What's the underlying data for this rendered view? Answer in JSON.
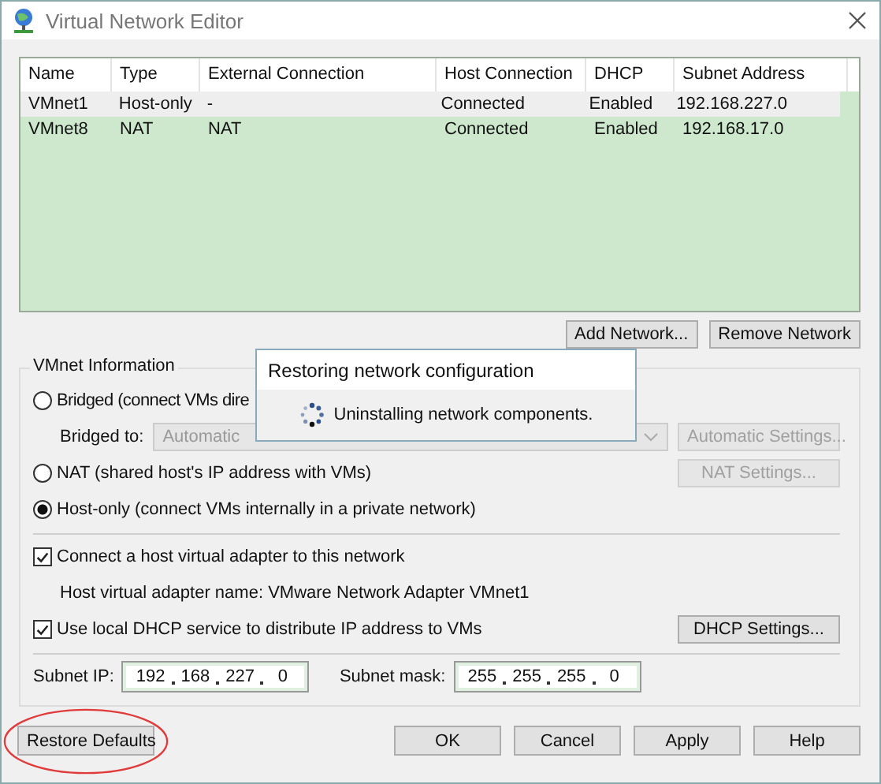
{
  "window": {
    "title": "Virtual Network Editor"
  },
  "table": {
    "columns": [
      "Name",
      "Type",
      "External Connection",
      "Host Connection",
      "DHCP",
      "Subnet Address"
    ],
    "rows": [
      {
        "cells": [
          "VMnet1",
          "Host-only",
          "-",
          "Connected",
          "Enabled",
          "192.168.227.0"
        ],
        "selected": true
      },
      {
        "cells": [
          "VMnet8",
          "NAT",
          "NAT",
          "Connected",
          "Enabled",
          "192.168.17.0"
        ],
        "selected": false
      }
    ]
  },
  "network_buttons": [
    {
      "label": "Add Network...",
      "disabled": false
    },
    {
      "label": "Remove Network",
      "disabled": false
    }
  ],
  "vmnet_info": {
    "title": "VMnet Information",
    "bridged": {
      "label": "Bridged (connect VMs dire",
      "selected": false
    },
    "bridged_to": {
      "label": "Bridged to:",
      "value": "Automatic",
      "disabled": true,
      "button": {
        "label": "Automatic Settings...",
        "disabled": true
      }
    },
    "nat": {
      "label": "NAT (shared host's IP address with VMs)",
      "selected": false,
      "button": {
        "label": "NAT Settings...",
        "disabled": true
      }
    },
    "host_only": {
      "label": "Host-only (connect VMs internally in a private network)",
      "selected": true
    },
    "connect_adapter": {
      "label": "Connect a host virtual adapter to this network",
      "checked": true
    },
    "adapter_name": "Host virtual adapter name: VMware Network Adapter VMnet1",
    "use_dhcp": {
      "label": "Use local DHCP service to distribute IP address to VMs",
      "checked": true,
      "button": {
        "label": "DHCP Settings...",
        "disabled": false
      }
    },
    "subnet_ip": {
      "label": "Subnet IP:",
      "octets": [
        "192",
        "168",
        "227",
        "0"
      ]
    },
    "subnet_mask": {
      "label": "Subnet mask:",
      "octets": [
        "255",
        "255",
        "255",
        "0"
      ]
    }
  },
  "progress_popup": {
    "title": "Restoring network configuration",
    "message": "Uninstalling network components."
  },
  "footer_buttons": [
    {
      "label": "Restore Defaults",
      "highlighted": true
    },
    {
      "label": "OK",
      "highlighted": false
    },
    {
      "label": "Cancel",
      "highlighted": false
    },
    {
      "label": "Apply",
      "highlighted": false
    },
    {
      "label": "Help",
      "highlighted": false
    }
  ]
}
